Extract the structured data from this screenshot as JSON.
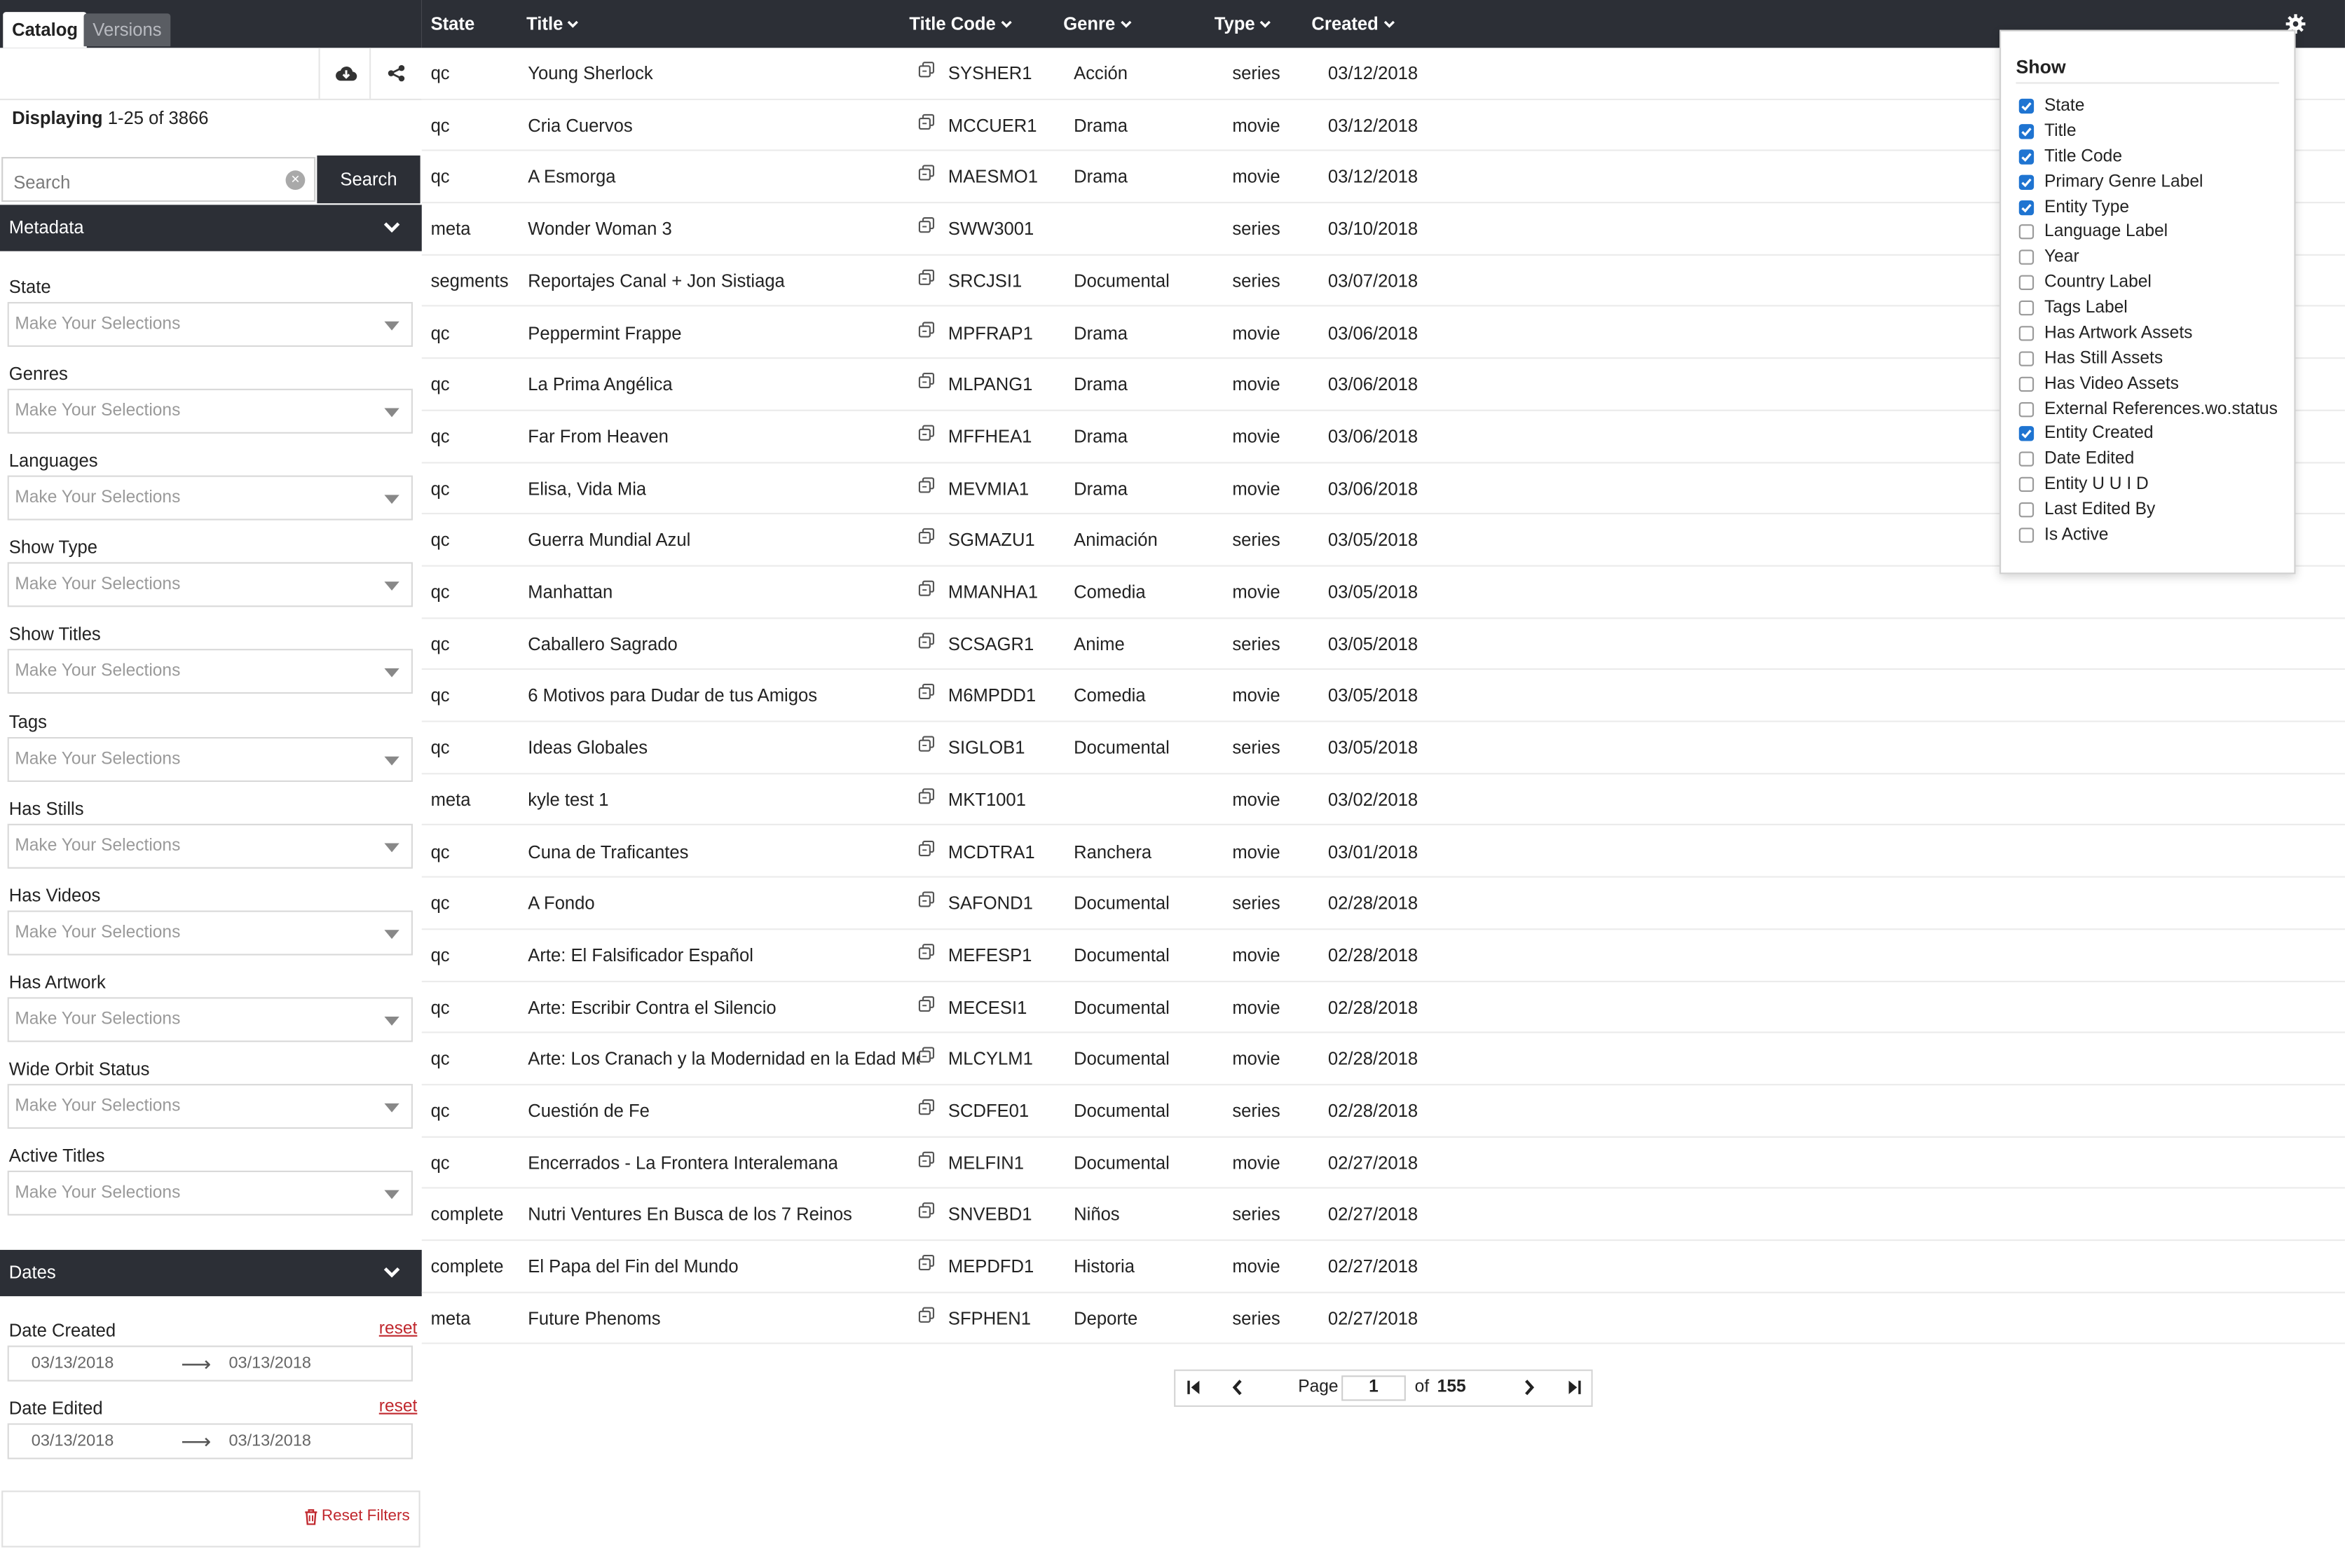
{
  "tabs": [
    {
      "label": "Catalog",
      "active": true
    },
    {
      "label": "Versions",
      "active": false
    }
  ],
  "toolbar": {
    "download_icon": "cloud-download-icon",
    "share_icon": "share-icon"
  },
  "displaying": {
    "prefix": "Displaying",
    "range": "1-25 of 3866"
  },
  "search": {
    "placeholder": "Search",
    "value": "",
    "button_label": "Search"
  },
  "metadata_section": {
    "title": "Metadata"
  },
  "filters": [
    {
      "label": "State",
      "placeholder": "Make Your Selections"
    },
    {
      "label": "Genres",
      "placeholder": "Make Your Selections"
    },
    {
      "label": "Languages",
      "placeholder": "Make Your Selections"
    },
    {
      "label": "Show Type",
      "placeholder": "Make Your Selections"
    },
    {
      "label": "Show Titles",
      "placeholder": "Make Your Selections"
    },
    {
      "label": "Tags",
      "placeholder": "Make Your Selections"
    },
    {
      "label": "Has Stills",
      "placeholder": "Make Your Selections"
    },
    {
      "label": "Has Videos",
      "placeholder": "Make Your Selections"
    },
    {
      "label": "Has Artwork",
      "placeholder": "Make Your Selections"
    },
    {
      "label": "Wide Orbit Status",
      "placeholder": "Make Your Selections"
    },
    {
      "label": "Active Titles",
      "placeholder": "Make Your Selections"
    }
  ],
  "dates_section": {
    "title": "Dates"
  },
  "date_filters": [
    {
      "label": "Date Created",
      "reset": "reset",
      "from": "03/13/2018",
      "to": "03/13/2018"
    },
    {
      "label": "Date Edited",
      "reset": "reset",
      "from": "03/13/2018",
      "to": "03/13/2018"
    }
  ],
  "reset_filters_label": "Reset Filters",
  "columns": [
    "State",
    "Title",
    "Title Code",
    "Genre",
    "Type",
    "Created"
  ],
  "rows": [
    {
      "state": "qc",
      "title": "Young Sherlock",
      "code": "SYSHER1",
      "genre": "Acción",
      "type": "series",
      "created": "03/12/2018"
    },
    {
      "state": "qc",
      "title": "Cria Cuervos",
      "code": "MCCUER1",
      "genre": "Drama",
      "type": "movie",
      "created": "03/12/2018"
    },
    {
      "state": "qc",
      "title": "A Esmorga",
      "code": "MAESMO1",
      "genre": "Drama",
      "type": "movie",
      "created": "03/12/2018"
    },
    {
      "state": "meta",
      "title": "Wonder Woman 3",
      "code": "SWW3001",
      "genre": "",
      "type": "series",
      "created": "03/10/2018"
    },
    {
      "state": "segments",
      "title": "Reportajes Canal + Jon Sistiaga",
      "code": "SRCJSI1",
      "genre": "Documental",
      "type": "series",
      "created": "03/07/2018"
    },
    {
      "state": "qc",
      "title": "Peppermint Frappe",
      "code": "MPFRAP1",
      "genre": "Drama",
      "type": "movie",
      "created": "03/06/2018"
    },
    {
      "state": "qc",
      "title": "La Prima Angélica",
      "code": "MLPANG1",
      "genre": "Drama",
      "type": "movie",
      "created": "03/06/2018"
    },
    {
      "state": "qc",
      "title": "Far From Heaven",
      "code": "MFFHEA1",
      "genre": "Drama",
      "type": "movie",
      "created": "03/06/2018"
    },
    {
      "state": "qc",
      "title": "Elisa, Vida Mia",
      "code": "MEVMIA1",
      "genre": "Drama",
      "type": "movie",
      "created": "03/06/2018"
    },
    {
      "state": "qc",
      "title": "Guerra Mundial Azul",
      "code": "SGMAZU1",
      "genre": "Animación",
      "type": "series",
      "created": "03/05/2018"
    },
    {
      "state": "qc",
      "title": "Manhattan",
      "code": "MMANHA1",
      "genre": "Comedia",
      "type": "movie",
      "created": "03/05/2018"
    },
    {
      "state": "qc",
      "title": "Caballero Sagrado",
      "code": "SCSAGR1",
      "genre": "Anime",
      "type": "series",
      "created": "03/05/2018"
    },
    {
      "state": "qc",
      "title": "6 Motivos para Dudar de tus Amigos",
      "code": "M6MPDD1",
      "genre": "Comedia",
      "type": "movie",
      "created": "03/05/2018"
    },
    {
      "state": "qc",
      "title": "Ideas Globales",
      "code": "SIGLOB1",
      "genre": "Documental",
      "type": "series",
      "created": "03/05/2018"
    },
    {
      "state": "meta",
      "title": "kyle test 1",
      "code": "MKT1001",
      "genre": "",
      "type": "movie",
      "created": "03/02/2018"
    },
    {
      "state": "qc",
      "title": "Cuna de Traficantes",
      "code": "MCDTRA1",
      "genre": "Ranchera",
      "type": "movie",
      "created": "03/01/2018"
    },
    {
      "state": "qc",
      "title": "A Fondo",
      "code": "SAFOND1",
      "genre": "Documental",
      "type": "series",
      "created": "02/28/2018"
    },
    {
      "state": "qc",
      "title": "Arte: El Falsificador Español",
      "code": "MEFESP1",
      "genre": "Documental",
      "type": "movie",
      "created": "02/28/2018"
    },
    {
      "state": "qc",
      "title": "Arte: Escribir Contra el Silencio",
      "code": "MECESI1",
      "genre": "Documental",
      "type": "movie",
      "created": "02/28/2018"
    },
    {
      "state": "qc",
      "title": "Arte: Los Cranach y la Modernidad en la Edad Media",
      "code": "MLCYLM1",
      "genre": "Documental",
      "type": "movie",
      "created": "02/28/2018"
    },
    {
      "state": "qc",
      "title": "Cuestión de Fe",
      "code": "SCDFE01",
      "genre": "Documental",
      "type": "series",
      "created": "02/28/2018"
    },
    {
      "state": "qc",
      "title": "Encerrados - La Frontera Interalemana",
      "code": "MELFIN1",
      "genre": "Documental",
      "type": "movie",
      "created": "02/27/2018"
    },
    {
      "state": "complete",
      "title": "Nutri Ventures En Busca de los 7 Reinos",
      "code": "SNVEBD1",
      "genre": "Niños",
      "type": "series",
      "created": "02/27/2018"
    },
    {
      "state": "complete",
      "title": "El Papa del Fin del Mundo",
      "code": "MEPDFD1",
      "genre": "Historia",
      "type": "movie",
      "created": "02/27/2018"
    },
    {
      "state": "meta",
      "title": "Future Phenoms",
      "code": "SFPHEN1",
      "genre": "Deporte",
      "type": "series",
      "created": "02/27/2018"
    }
  ],
  "pager": {
    "page_label": "Page",
    "page": "1",
    "of_label": "of",
    "total": "155"
  },
  "show_panel": {
    "title": "Show",
    "options": [
      {
        "label": "State",
        "checked": true
      },
      {
        "label": "Title",
        "checked": true
      },
      {
        "label": "Title Code",
        "checked": true
      },
      {
        "label": "Primary Genre Label",
        "checked": true
      },
      {
        "label": "Entity Type",
        "checked": true
      },
      {
        "label": "Language Label",
        "checked": false
      },
      {
        "label": "Year",
        "checked": false
      },
      {
        "label": "Country Label",
        "checked": false
      },
      {
        "label": "Tags Label",
        "checked": false
      },
      {
        "label": "Has Artwork Assets",
        "checked": false
      },
      {
        "label": "Has Still Assets",
        "checked": false
      },
      {
        "label": "Has Video Assets",
        "checked": false
      },
      {
        "label": "External References.wo.status",
        "checked": false
      },
      {
        "label": "Entity Created",
        "checked": true
      },
      {
        "label": "Date Edited",
        "checked": false
      },
      {
        "label": "Entity U U I D",
        "checked": false
      },
      {
        "label": "Last Edited By",
        "checked": false
      },
      {
        "label": "Is Active",
        "checked": false
      }
    ]
  },
  "colors": {
    "dark": "#2c2f36",
    "reset": "#c0272d",
    "checkbox": "#1f74d1"
  }
}
